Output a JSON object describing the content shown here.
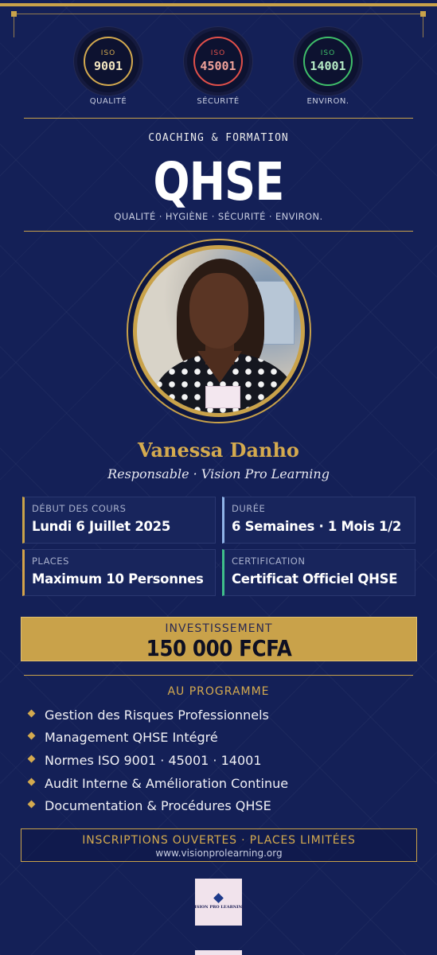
{
  "badges": [
    {
      "prefix": "ISO",
      "number": "9001",
      "caption": "QUALITÉ",
      "color": "#d4aa4f"
    },
    {
      "prefix": "ISO",
      "number": "45001",
      "caption": "SÉCURITÉ",
      "color": "#e2504a"
    },
    {
      "prefix": "ISO",
      "number": "14001",
      "caption": "ENVIRON.",
      "color": "#3fbf6a"
    }
  ],
  "header": {
    "kicker": "COACHING & FORMATION",
    "title": "QHSE",
    "tagline": "QUALITÉ · HYGIÈNE · SÉCURITÉ · ENVIRON."
  },
  "trainer": {
    "name": "Vanessa Danho",
    "role": "Responsable · Vision Pro Learning"
  },
  "info_cards": [
    {
      "label": "DÉBUT DES COURS",
      "value": "Lundi 6 Juillet 2025",
      "accent": "#c9a24a"
    },
    {
      "label": "DURÉE",
      "value": "6 Semaines · 1 Mois 1/2",
      "accent": "#8fb4e8"
    },
    {
      "label": "PLACES",
      "value": "Maximum 10 Personnes",
      "accent": "#d4a24a"
    },
    {
      "label": "CERTIFICATION",
      "value": "Certificat Officiel QHSE",
      "accent": "#3fbf8a"
    }
  ],
  "price": {
    "label": "INVESTISSEMENT",
    "value": "150 000 FCFA"
  },
  "program": {
    "title": "AU PROGRAMME",
    "items": [
      "Gestion des Risques Professionnels",
      "Management QHSE Intégré",
      "Normes ISO 9001 · 45001 · 14001",
      "Audit Interne & Amélioration Continue",
      "Documentation & Procédures QHSE"
    ]
  },
  "cta": {
    "headline": "INSCRIPTIONS OUVERTES · PLACES LIMITÉES",
    "url": "www.visionprolearning.org"
  },
  "footer_logo": {
    "brand": "VISION PRO LEARNING"
  },
  "colors": {
    "background": "#142057",
    "gold": "#c9a24a"
  }
}
